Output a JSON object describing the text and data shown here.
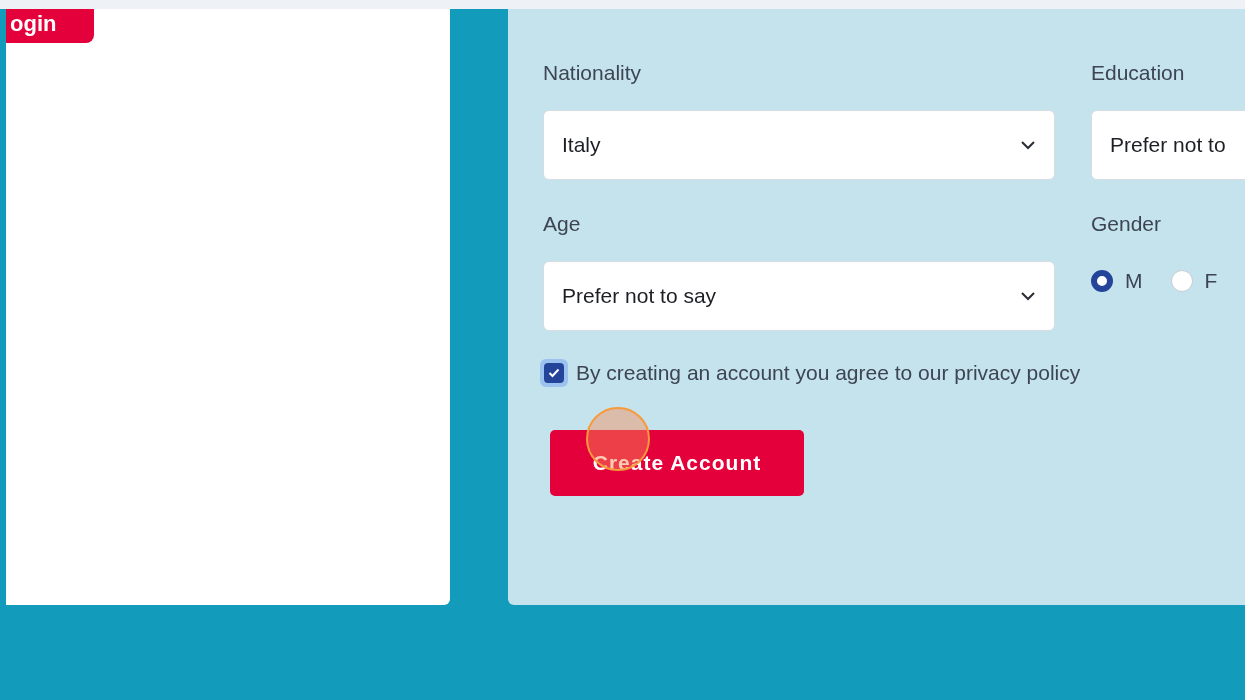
{
  "login_button": {
    "label": "ogin"
  },
  "form": {
    "fields": [
      {
        "kind": "select",
        "label": "Nationality",
        "value": "Italy"
      },
      {
        "kind": "select",
        "label": "Education",
        "value": "Prefer not to"
      },
      {
        "kind": "select",
        "label": "Age",
        "value": "Prefer not to say"
      },
      {
        "kind": "radio",
        "label": "Gender",
        "options": [
          {
            "label": "M",
            "selected": true
          },
          {
            "label": "F",
            "selected": false
          }
        ]
      }
    ],
    "consent": {
      "label": "By creating an account you agree to our privacy policy",
      "checked": true
    },
    "submit": {
      "label": "Create Account"
    }
  }
}
